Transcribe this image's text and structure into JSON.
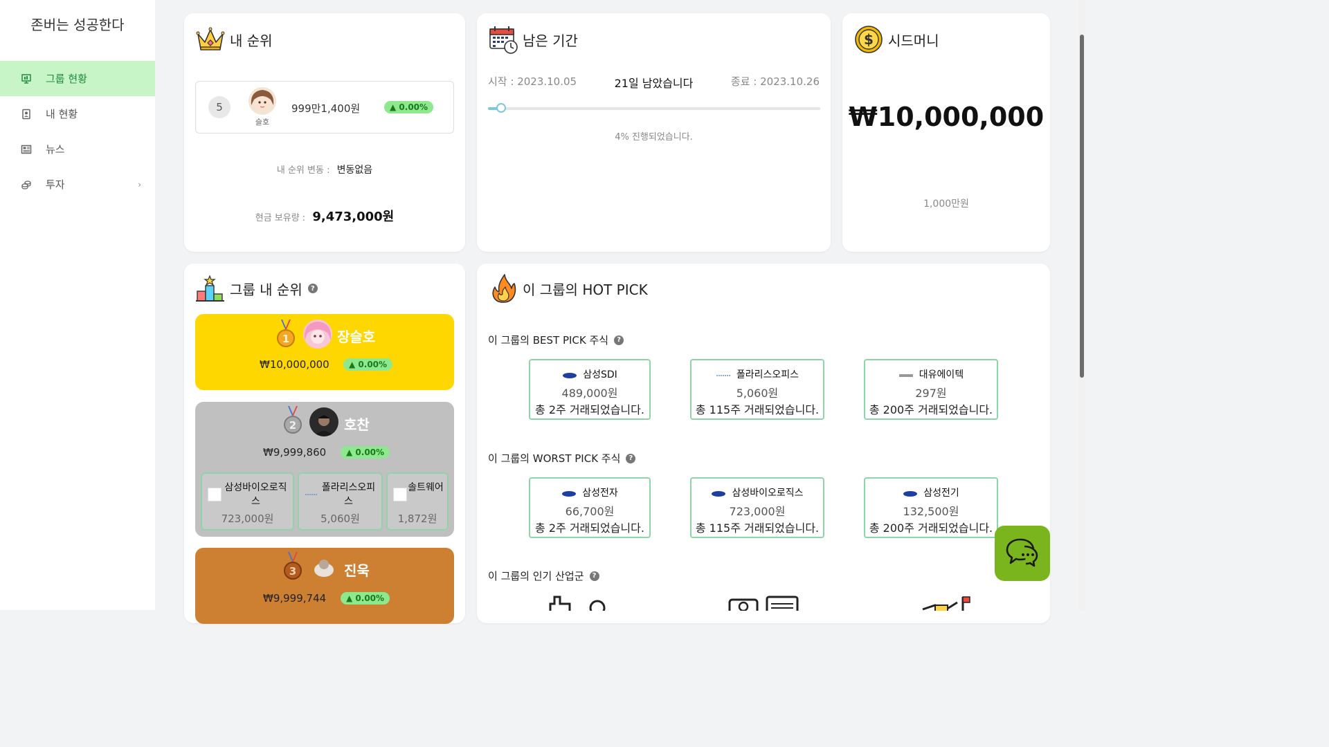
{
  "brand": "존버는 성공한다",
  "nav": [
    {
      "label": "그룹 현황",
      "icon": "presentation-icon",
      "active": true
    },
    {
      "label": "내 현황",
      "icon": "portrait-icon"
    },
    {
      "label": "뉴스",
      "icon": "newspaper-icon"
    },
    {
      "label": "투자",
      "icon": "coins-icon",
      "chevron": "›"
    }
  ],
  "my_rank": {
    "title": "내 순위",
    "rank": "5",
    "name": "슬호",
    "money": "999만1,400원",
    "change": "▲ 0.00%",
    "rank_change_label": "내 순위 변동 :",
    "rank_change_value": "변동없음",
    "cash_label": "현금 보유량 :",
    "cash_value": "9,473,000원"
  },
  "period": {
    "title": "남은 기간",
    "start": "시작 : 2023.10.05",
    "remaining": "21일 남았습니다",
    "end": "종료 : 2023.10.26",
    "progress": 0.04,
    "progress_text": "4% 진행되었습니다."
  },
  "seed": {
    "title": "시드머니",
    "amount": "₩10,000,000",
    "sub": "1,000만원"
  },
  "group_rank": {
    "title": "그룹 내 순위",
    "help": "?",
    "entries": [
      {
        "medal": "1",
        "name": "장슬호",
        "money": "₩10,000,000",
        "change": "▲ 0.00%",
        "color": "#ffd700"
      },
      {
        "medal": "2",
        "name": "호찬",
        "money": "₩9,999,860",
        "change": "▲ 0.00%",
        "color": "#c0c0c0",
        "stocks": [
          {
            "name": "삼성바이오로직스",
            "price": "723,000원"
          },
          {
            "name": "폴라리스오피스",
            "price": "5,060원"
          },
          {
            "name": "솔트웨어",
            "price": "1,872원"
          }
        ]
      },
      {
        "medal": "3",
        "name": "진욱",
        "money": "₩9,999,744",
        "change": "▲ 0.00%",
        "color": "#cd7f32"
      }
    ]
  },
  "hot_pick": {
    "title": "이 그룹의 HOT PICK",
    "best_label": "이 그룹의 BEST PICK 주식",
    "best": [
      {
        "name": "삼성SDI",
        "price": "489,000원",
        "volume": "총 2주 거래되었습니다."
      },
      {
        "name": "폴라리스오피스",
        "price": "5,060원",
        "volume": "총 115주 거래되었습니다."
      },
      {
        "name": "대유에이텍",
        "price": "297원",
        "volume": "총 200주 거래되었습니다."
      }
    ],
    "worst_label": "이 그룹의 WORST PICK 주식",
    "worst": [
      {
        "name": "삼성전자",
        "price": "66,700원",
        "volume": "총 2주 거래되었습니다."
      },
      {
        "name": "삼성바이오로직스",
        "price": "723,000원",
        "volume": "총 115주 거래되었습니다."
      },
      {
        "name": "삼성전기",
        "price": "132,500원",
        "volume": "총 200주 거래되었습니다."
      }
    ],
    "industry_label": "이 그룹의 인기 산업군",
    "help": "?"
  },
  "colors": {
    "accent_green": "#c8f5c8",
    "pill": "#8ee88e",
    "chip_border": "#8fd3a9",
    "chat": "#7ab51d"
  }
}
